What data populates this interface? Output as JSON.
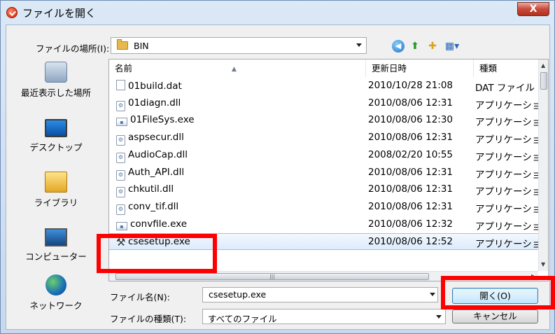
{
  "window": {
    "title": "ファイルを開く",
    "close_label": "X"
  },
  "location": {
    "label": "ファイルの場所(I):",
    "value": "BIN"
  },
  "toolbar_icons": [
    "back-icon",
    "up-folder-icon",
    "new-folder-icon",
    "view-menu-icon"
  ],
  "places": [
    {
      "label": "最近表示した場所",
      "icon": "recent-places-icon"
    },
    {
      "label": "デスクトップ",
      "icon": "desktop-icon"
    },
    {
      "label": "ライブラリ",
      "icon": "library-icon"
    },
    {
      "label": "コンピューター",
      "icon": "computer-icon"
    },
    {
      "label": "ネットワーク",
      "icon": "network-icon"
    }
  ],
  "columns": {
    "name": "名前",
    "date": "更新日時",
    "type": "種類"
  },
  "files": [
    {
      "name": "01build.dat",
      "date": "2010/10/28 21:08",
      "type": "DAT ファイル",
      "icon": "dat"
    },
    {
      "name": "01diagn.dll",
      "date": "2010/08/06 12:31",
      "type": "アプリケーション",
      "icon": "dll"
    },
    {
      "name": "01FileSys.exe",
      "date": "2010/08/06 12:30",
      "type": "アプリケーション",
      "icon": "exe"
    },
    {
      "name": "aspsecur.dll",
      "date": "2010/08/06 12:31",
      "type": "アプリケーション",
      "icon": "dll"
    },
    {
      "name": "AudioCap.dll",
      "date": "2008/02/20 10:55",
      "type": "アプリケーション",
      "icon": "dll"
    },
    {
      "name": "Auth_API.dll",
      "date": "2010/08/06 12:31",
      "type": "アプリケーション",
      "icon": "dll"
    },
    {
      "name": "chkutil.dll",
      "date": "2010/08/06 12:31",
      "type": "アプリケーション",
      "icon": "dll"
    },
    {
      "name": "conv_tif.dll",
      "date": "2010/08/06 12:31",
      "type": "アプリケーション",
      "icon": "dll"
    },
    {
      "name": "convfile.exe",
      "date": "2010/08/06 12:32",
      "type": "アプリケーション",
      "icon": "exe"
    },
    {
      "name": "csesetup.exe",
      "date": "2010/08/06 12:52",
      "type": "アプリケーション",
      "icon": "setup",
      "selected": true
    }
  ],
  "filename": {
    "label": "ファイル名(N):",
    "value": "csesetup.exe"
  },
  "filetype": {
    "label": "ファイルの種類(T):",
    "value": "すべてのファイル"
  },
  "buttons": {
    "open": "開く(O)",
    "cancel": "キャンセル"
  },
  "highlight_color": "#ff0000"
}
